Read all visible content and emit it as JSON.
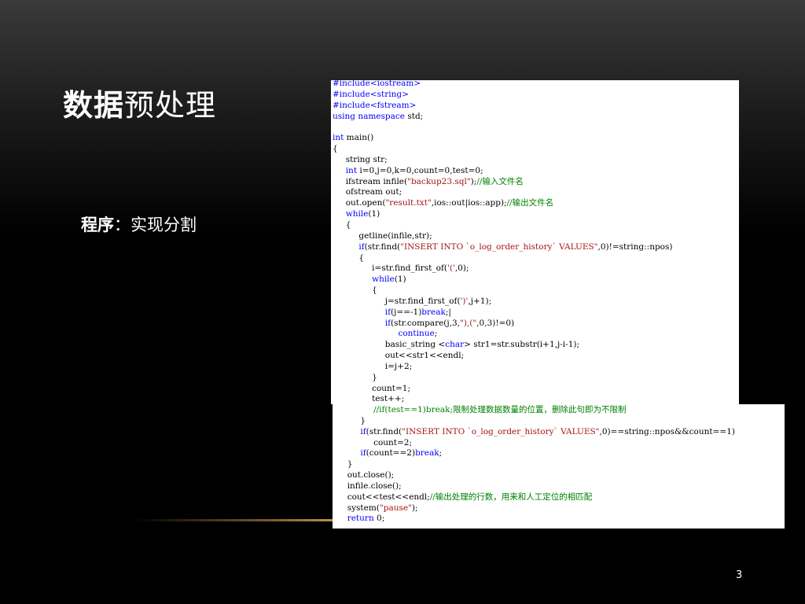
{
  "slide": {
    "title_bold": "数据",
    "title_rest": "预处理",
    "subtitle_bold": "程序",
    "subtitle_rest": "：实现分割",
    "page_number": "3"
  },
  "colors": {
    "keyword": "#0000ff",
    "string": "#a31515",
    "comment": "#008000",
    "plain": "#000000"
  },
  "code_panel_1": [
    [
      [
        "#include<iostream>",
        "k"
      ]
    ],
    [
      [
        "#include<string>",
        "k"
      ]
    ],
    [
      [
        "#include<fstream>",
        "k"
      ]
    ],
    [
      [
        "using namespace",
        "k"
      ],
      [
        " std;",
        ""
      ]
    ],
    [
      [
        "",
        ""
      ]
    ],
    [
      [
        "int",
        "k"
      ],
      [
        " main()",
        ""
      ]
    ],
    [
      [
        "{",
        ""
      ]
    ],
    [
      [
        "     string str;",
        ""
      ]
    ],
    [
      [
        "     ",
        ""
      ],
      [
        "int",
        "k"
      ],
      [
        " i=0,j=0,k=0,count=0,test=0;",
        ""
      ]
    ],
    [
      [
        "     ifstream infile(",
        ""
      ],
      [
        "\"backup23.sql\"",
        "s"
      ],
      [
        ");",
        ""
      ],
      [
        "//输入文件名",
        "c"
      ]
    ],
    [
      [
        "     ofstream out;",
        ""
      ]
    ],
    [
      [
        "     out.open(",
        ""
      ],
      [
        "\"result.txt\"",
        "s"
      ],
      [
        ",ios::out|ios::app);",
        ""
      ],
      [
        "//输出文件名",
        "c"
      ]
    ],
    [
      [
        "     ",
        ""
      ],
      [
        "while",
        "k"
      ],
      [
        "(1)",
        ""
      ]
    ],
    [
      [
        "     {",
        ""
      ]
    ],
    [
      [
        "          getline(infile,str);",
        ""
      ]
    ],
    [
      [
        "          ",
        ""
      ],
      [
        "if",
        "k"
      ],
      [
        "(str.find(",
        ""
      ],
      [
        "\"INSERT INTO `o_log_order_history` VALUES\"",
        "s"
      ],
      [
        ",0)!=string::npos)",
        ""
      ]
    ],
    [
      [
        "          {",
        ""
      ]
    ],
    [
      [
        "               i=str.find_first_of(",
        ""
      ],
      [
        "'('",
        "s"
      ],
      [
        ",0);",
        ""
      ]
    ],
    [
      [
        "               ",
        ""
      ],
      [
        "while",
        "k"
      ],
      [
        "(1)",
        ""
      ]
    ],
    [
      [
        "               {",
        ""
      ]
    ],
    [
      [
        "                    j=str.find_first_of(",
        ""
      ],
      [
        "')'",
        "s"
      ],
      [
        ",j+1);",
        ""
      ]
    ],
    [
      [
        "                    ",
        ""
      ],
      [
        "if",
        "k"
      ],
      [
        "(j==-1)",
        ""
      ],
      [
        "break",
        "k"
      ],
      [
        ";|",
        ""
      ]
    ],
    [
      [
        "                    ",
        ""
      ],
      [
        "if",
        "k"
      ],
      [
        "(str.compare(j,3,",
        ""
      ],
      [
        "\"),(\"",
        "s"
      ],
      [
        ",0,3)!=0)",
        ""
      ]
    ],
    [
      [
        "                         ",
        ""
      ],
      [
        "continue",
        "k"
      ],
      [
        ";",
        ""
      ]
    ],
    [
      [
        "                    basic_string <",
        ""
      ],
      [
        "char",
        "k"
      ],
      [
        "> str1=str.substr(i+1,j-i-1);",
        ""
      ]
    ],
    [
      [
        "                    out<<str1<<endl;",
        ""
      ]
    ],
    [
      [
        "                    i=j+2;",
        ""
      ]
    ],
    [
      [
        "               }",
        ""
      ]
    ],
    [
      [
        "               count=1;",
        ""
      ]
    ],
    [
      [
        "               test++;",
        ""
      ]
    ]
  ],
  "code_panel_2": [
    [
      [
        "               ",
        ""
      ],
      [
        "//if(test==1)break;限制处理数据数量的位置，删除此句即为不限制",
        "c"
      ]
    ],
    [
      [
        "          }",
        ""
      ]
    ],
    [
      [
        "          ",
        ""
      ],
      [
        "if",
        "k"
      ],
      [
        "(str.find(",
        ""
      ],
      [
        "\"INSERT INTO `o_log_order_history` VALUES\"",
        "s"
      ],
      [
        ",0)==string::npos&&count==1)",
        ""
      ]
    ],
    [
      [
        "               count=2;",
        ""
      ]
    ],
    [
      [
        "          ",
        ""
      ],
      [
        "if",
        "k"
      ],
      [
        "(count==2)",
        ""
      ],
      [
        "break",
        "k"
      ],
      [
        ";",
        ""
      ]
    ],
    [
      [
        "     }",
        ""
      ]
    ],
    [
      [
        "     out.close();",
        ""
      ]
    ],
    [
      [
        "     infile.close();",
        ""
      ]
    ],
    [
      [
        "     cout<<test<<endl;",
        ""
      ],
      [
        "//输出处理的行数，用来和人工定位的相匹配",
        "c"
      ]
    ],
    [
      [
        "     system(",
        ""
      ],
      [
        "\"pause\"",
        "s"
      ],
      [
        ");",
        ""
      ]
    ],
    [
      [
        "     ",
        ""
      ],
      [
        "return",
        "k"
      ],
      [
        " 0;",
        ""
      ]
    ]
  ]
}
